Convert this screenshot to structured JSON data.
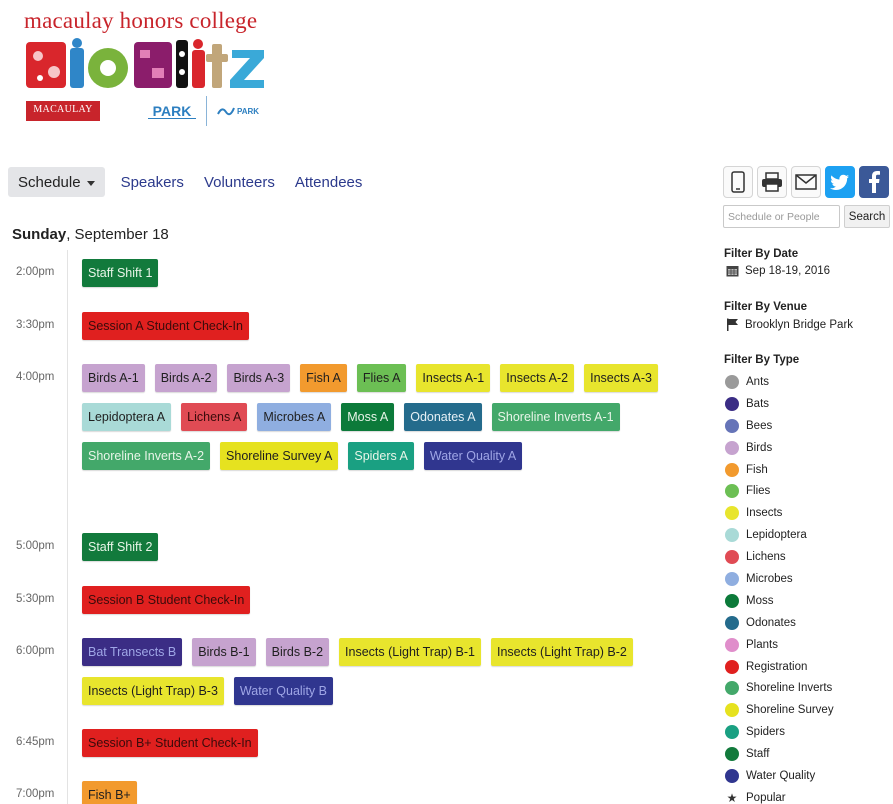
{
  "logo": {
    "title": "macaulay honors college",
    "wordmark": "BioBlitz",
    "macaulay_badge": "MACAULAY",
    "park_badge": "PARK",
    "conservancy_badge": "PARK"
  },
  "nav": {
    "schedule_label": "Schedule",
    "links": [
      "Speakers",
      "Volunteers",
      "Attendees"
    ]
  },
  "day": {
    "weekday": "Sunday",
    "date": ", September 18"
  },
  "slots": [
    {
      "time": "2:00pm",
      "events": [
        {
          "label": "Staff Shift 1",
          "type": "Staff"
        }
      ]
    },
    {
      "time": "3:30pm",
      "events": [
        {
          "label": "Session A Student Check-In",
          "type": "Registration"
        }
      ]
    },
    {
      "time": "4:00pm",
      "events": [
        {
          "label": "Birds A-1",
          "type": "Birds"
        },
        {
          "label": "Birds A-2",
          "type": "Birds"
        },
        {
          "label": "Birds A-3",
          "type": "Birds"
        },
        {
          "label": "Fish A",
          "type": "Fish"
        },
        {
          "label": "Flies A",
          "type": "Flies"
        },
        {
          "label": "Insects A-1",
          "type": "Insects"
        },
        {
          "label": "Insects A-2",
          "type": "Insects"
        },
        {
          "label": "Insects A-3",
          "type": "Insects"
        },
        {
          "label": "Lepidoptera A",
          "type": "Lepidoptera"
        },
        {
          "label": "Lichens A",
          "type": "Lichens"
        },
        {
          "label": "Microbes A",
          "type": "Microbes"
        },
        {
          "label": "Moss A",
          "type": "Moss"
        },
        {
          "label": "Odonates A",
          "type": "Odonates"
        },
        {
          "label": "Shoreline Inverts A-1",
          "type": "Shoreline Inverts"
        },
        {
          "label": "Shoreline Inverts A-2",
          "type": "Shoreline Inverts"
        },
        {
          "label": "Shoreline Survey A",
          "type": "Shoreline Survey"
        },
        {
          "label": "Spiders A",
          "type": "Spiders"
        },
        {
          "label": "Water Quality A",
          "type": "Water Quality"
        }
      ]
    },
    {
      "time": "5:00pm",
      "events": [
        {
          "label": "Staff Shift 2",
          "type": "Staff"
        }
      ]
    },
    {
      "time": "5:30pm",
      "events": [
        {
          "label": "Session B Student Check-In",
          "type": "Registration"
        }
      ]
    },
    {
      "time": "6:00pm",
      "events": [
        {
          "label": "Bat Transects B",
          "type": "Bats"
        },
        {
          "label": "Birds B-1",
          "type": "Birds"
        },
        {
          "label": "Birds B-2",
          "type": "Birds"
        },
        {
          "label": "Insects (Light Trap) B-1",
          "type": "Insects"
        },
        {
          "label": "Insects (Light Trap) B-2",
          "type": "Insects"
        },
        {
          "label": "Insects (Light Trap) B-3",
          "type": "Insects"
        },
        {
          "label": "Water Quality B",
          "type": "Water Quality"
        }
      ]
    },
    {
      "time": "6:45pm",
      "events": [
        {
          "label": "Session B+ Student Check-In",
          "type": "Registration"
        }
      ]
    },
    {
      "time": "7:00pm",
      "events": [
        {
          "label": "Fish B+",
          "type": "Fish"
        }
      ]
    }
  ],
  "share": {
    "icons": [
      "mobile-icon",
      "print-icon",
      "email-icon",
      "twitter-icon",
      "facebook-icon"
    ]
  },
  "search": {
    "placeholder": "Schedule or People",
    "button_label": "Search"
  },
  "filters": {
    "date_heading": "Filter By Date",
    "date_value": "Sep 18-19, 2016",
    "venue_heading": "Filter By Venue",
    "venue_value": "Brooklyn Bridge Park",
    "type_heading": "Filter By Type",
    "types": [
      {
        "name": "Ants",
        "color": "#9a9a9a"
      },
      {
        "name": "Bats",
        "color": "#3b2d85"
      },
      {
        "name": "Bees",
        "color": "#6674b8"
      },
      {
        "name": "Birds",
        "color": "#c6a3cf"
      },
      {
        "name": "Fish",
        "color": "#f29a2e"
      },
      {
        "name": "Flies",
        "color": "#6cbf54"
      },
      {
        "name": "Insects",
        "color": "#e8e52d"
      },
      {
        "name": "Lepidoptera",
        "color": "#a9dad7"
      },
      {
        "name": "Lichens",
        "color": "#e04b54"
      },
      {
        "name": "Microbes",
        "color": "#8faee0"
      },
      {
        "name": "Moss",
        "color": "#0c7a3a"
      },
      {
        "name": "Odonates",
        "color": "#246b8c"
      },
      {
        "name": "Plants",
        "color": "#e08ecb"
      },
      {
        "name": "Registration",
        "color": "#e0201f"
      },
      {
        "name": "Shoreline Inverts",
        "color": "#43a86a"
      },
      {
        "name": "Shoreline Survey",
        "color": "#e6e21f"
      },
      {
        "name": "Spiders",
        "color": "#1aa082"
      },
      {
        "name": "Staff",
        "color": "#127a3c"
      },
      {
        "name": "Water Quality",
        "color": "#30368f"
      }
    ],
    "popular_label": "Popular"
  }
}
